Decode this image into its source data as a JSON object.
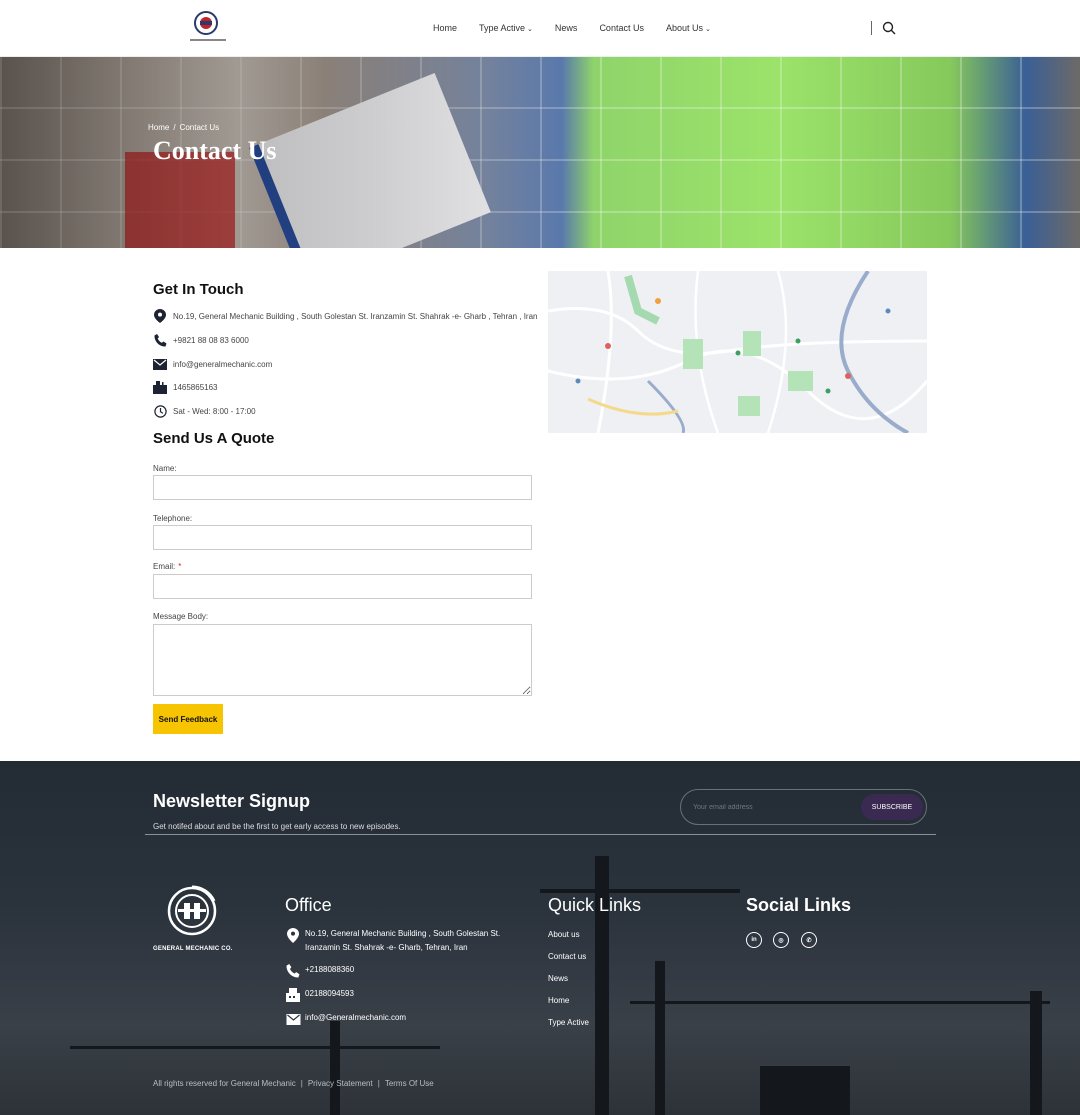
{
  "header": {
    "nav": [
      {
        "label": "Home",
        "dropdown": false
      },
      {
        "label": "Type Active",
        "dropdown": true
      },
      {
        "label": "News",
        "dropdown": false
      },
      {
        "label": "Contact Us",
        "dropdown": false
      },
      {
        "label": "About Us",
        "dropdown": true
      }
    ],
    "chevron": "⌄",
    "logo_icon": "company-logo",
    "search_icon": "search-icon"
  },
  "hero": {
    "breadcrumb_home": "Home",
    "breadcrumb_separator": "/",
    "breadcrumb_current": "Contact Us",
    "title": "Contact Us"
  },
  "contact": {
    "heading": "Get In Touch",
    "address": "No.19, General Mechanic Building , South Golestan St. Iranzamin St. Shahrak -e- Gharb , Tehran , Iran",
    "phone": "+9821 88 08 83 6000",
    "email": "info@generalmechanic.com",
    "postal": "1465865163",
    "hours": "Sat - Wed: 8:00 - 17:00"
  },
  "form": {
    "heading": "Send Us A Quote",
    "name_label": "Name:",
    "telephone_label": "Telephone:",
    "email_label": "Email:",
    "required_mark": "*",
    "message_label": "Message Body:",
    "submit_label": "Send Feedback"
  },
  "newsletter": {
    "title": "Newsletter Signup",
    "subtitle": "Get notifed about and be the first to get early access to new episodes.",
    "placeholder": "Your email address",
    "button": "SUBSCRIBE"
  },
  "footer": {
    "logo_name": "GENERAL MECHANIC CO.",
    "office_heading": "Office",
    "office_address": "No.19, General Mechanic Building , South Golestan St. Iranzamin St. Shahrak -e- Gharb, Tehran, Iran",
    "office_phone": "+2188088360",
    "office_fax": "02188094593",
    "office_email": "info@Generalmechanic.com",
    "quick_heading": "Quick Links",
    "quick_links": [
      "About us",
      "Contact us",
      "News",
      "Home",
      "Type Active"
    ],
    "social_heading": "Social Links",
    "social": [
      {
        "icon": "linkedin-icon",
        "glyph": "in"
      },
      {
        "icon": "instagram-icon",
        "glyph": "◎"
      },
      {
        "icon": "whatsapp-icon",
        "glyph": "✆"
      }
    ],
    "copyright": "All rights reserved for General Mechanic",
    "privacy": "Privacy Statement",
    "terms": "Terms Of Use",
    "link_separator": "|"
  },
  "colors": {
    "accent_yellow": "#f6c400",
    "footer_bg": "#2a323c",
    "subscribe_bg": "#3a2a52"
  }
}
